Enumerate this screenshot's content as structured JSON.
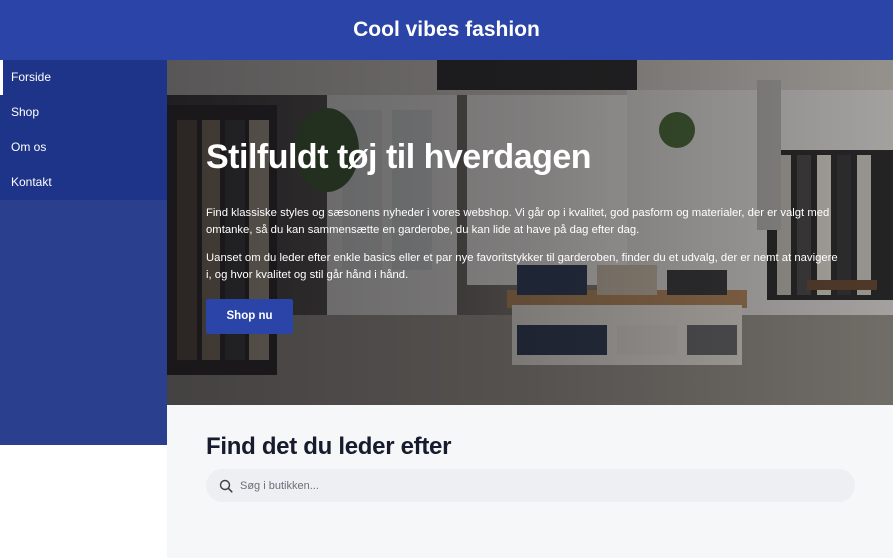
{
  "header": {
    "title": "Cool vibes fashion"
  },
  "sidebar": {
    "items": [
      {
        "label": "Forside",
        "active": true
      },
      {
        "label": "Shop",
        "active": false
      },
      {
        "label": "Om os",
        "active": false
      },
      {
        "label": "Kontakt",
        "active": false
      }
    ]
  },
  "hero": {
    "heading": "Stilfuldt tøj til hverdagen",
    "paragraph1": "Find klassiske styles og sæsonens nyheder i vores webshop. Vi går op i kvalitet, god pasform og materialer, der er valgt med omtanke, så du kan sammensætte en garderobe, du kan lide at have på dag efter dag.",
    "paragraph2": "Uanset om du leder efter enkle basics eller et par nye favoritstykker til garderoben, finder du et udvalg, der er nemt at navigere i, og hvor kvalitet og stil går hånd i hånd.",
    "button_label": "Shop nu"
  },
  "search": {
    "heading": "Find det du leder efter",
    "placeholder": "Søg i butikken...",
    "value": ""
  },
  "colors": {
    "brand": "#2a44a8",
    "sidebar_top": "#1e3488",
    "sidebar_bottom": "#2b3f8f"
  }
}
